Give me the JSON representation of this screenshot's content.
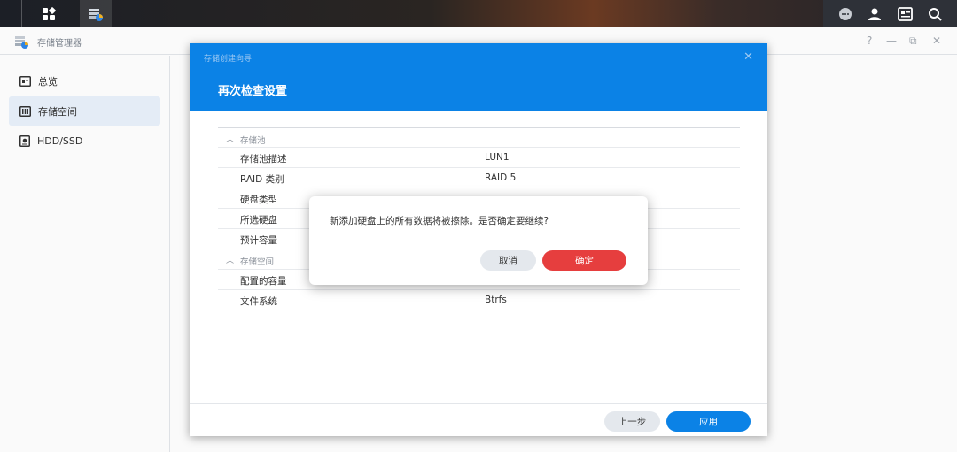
{
  "window": {
    "title": "存储管理器",
    "controls": [
      "?",
      "—",
      "⧉",
      "✕"
    ]
  },
  "sidebar": {
    "items": [
      {
        "label": "总览",
        "icon": "overview-icon"
      },
      {
        "label": "存储空间",
        "icon": "storage-icon",
        "active": true
      },
      {
        "label": "HDD/SSD",
        "icon": "disk-icon"
      }
    ]
  },
  "wizard": {
    "header_small": "存储创建向导",
    "title": "再次检查设置",
    "sections": [
      {
        "label": "存储池",
        "rows": [
          {
            "key": "存储池描述",
            "value": "LUN1"
          },
          {
            "key": "RAID 类别",
            "value": "RAID 5"
          },
          {
            "key": "硬盘类型",
            "value": ""
          },
          {
            "key": "所选硬盘",
            "value": ""
          },
          {
            "key": "预计容量",
            "value": ""
          }
        ]
      },
      {
        "label": "存储空间",
        "rows": [
          {
            "key": "配置的容量",
            "value": ""
          },
          {
            "key": "文件系统",
            "value": "Btrfs"
          }
        ]
      }
    ],
    "prev_label": "上一步",
    "apply_label": "应用"
  },
  "confirm": {
    "message": "新添加硬盘上的所有数据将被擦除。是否确定要继续?",
    "cancel_label": "取消",
    "ok_label": "确定"
  },
  "colors": {
    "accent": "#0b82e6",
    "danger": "#e63e3e"
  }
}
